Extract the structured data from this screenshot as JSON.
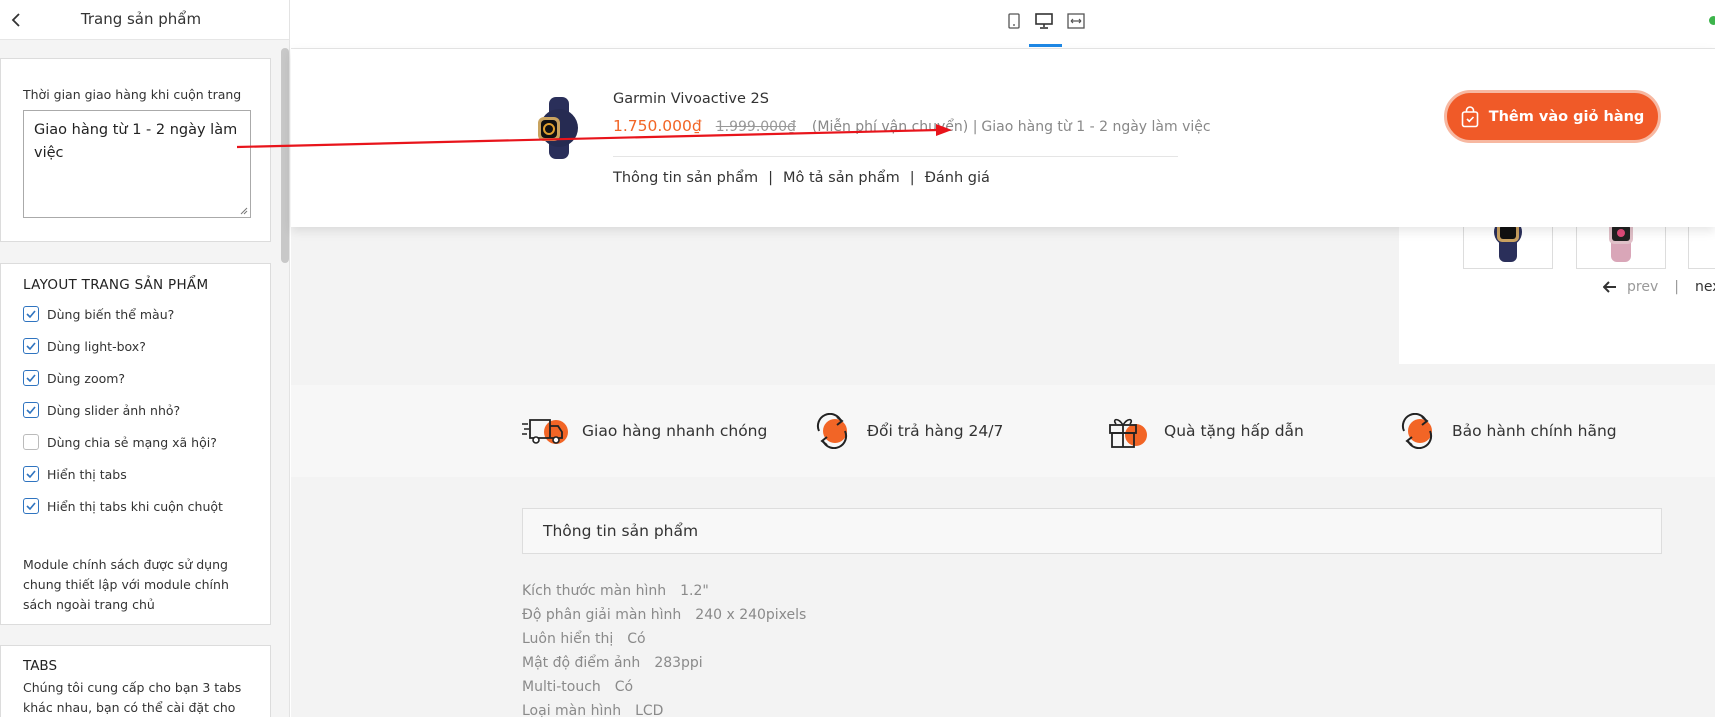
{
  "sidebar": {
    "title": "Trang sản phẩm",
    "delivery_field": {
      "label": "Thời gian giao hàng khi cuộn trang",
      "value": "Giao hàng từ 1 - 2 ngày làm việc"
    },
    "layout_section": {
      "title": "LAYOUT TRANG SẢN PHẨM",
      "options": [
        {
          "label": "Dùng biến thể màu?",
          "checked": true
        },
        {
          "label": "Dùng light-box?",
          "checked": true
        },
        {
          "label": "Dùng zoom?",
          "checked": true
        },
        {
          "label": "Dùng slider ảnh nhỏ?",
          "checked": true
        },
        {
          "label": "Dùng chia sẻ mạng xã hội?",
          "checked": false
        },
        {
          "label": "Hiển thị tabs",
          "checked": true
        },
        {
          "label": "Hiển thị tabs khi cuộn chuột",
          "checked": true
        }
      ],
      "note": "Module chính sách được sử dụng chung thiết lập với module chính sách ngoài trang chủ"
    },
    "tabs_section": {
      "title": "TABS",
      "description": "Chúng tôi cung cấp cho bạn 3 tabs khác nhau, bạn có thể cài đặt cho"
    }
  },
  "topbar": {
    "devices": [
      "mobile-icon",
      "desktop-icon",
      "fullwidth-icon"
    ],
    "active_device": "desktop-icon"
  },
  "sticky_bar": {
    "product_name": "Garmin Vivoactive 2S",
    "price": "1.750.000₫",
    "old_price": "1.999.000₫",
    "shipping_free": "(Miễn phí vận chuyển) |",
    "shipping_time": "Giao hàng từ 1 - 2 ngày làm việc",
    "tabs": [
      "Thông tin sản phẩm",
      "Mô tả sản phẩm",
      "Đánh giá"
    ],
    "tab_separator": "|",
    "cart_button": "Thêm vào giỏ hàng"
  },
  "gallery": {
    "prev": "prev",
    "sep": "|",
    "next": "next"
  },
  "policies": [
    {
      "icon": "delivery-truck-icon",
      "label": "Giao hàng nhanh chóng"
    },
    {
      "icon": "exchange-icon",
      "label": "Đổi trả hàng 24/7"
    },
    {
      "icon": "gift-icon",
      "label": "Quà tặng hấp dẫn"
    },
    {
      "icon": "warranty-icon",
      "label": "Bảo hành chính hãng"
    }
  ],
  "product_info": {
    "title": "Thông tin sản phẩm",
    "specs": [
      {
        "label": "Kích thước màn hình",
        "value": "1.2\""
      },
      {
        "label": "Độ phân giải màn hình",
        "value": "240 x 240pixels"
      },
      {
        "label": "Luôn hiển thị",
        "value": "Có"
      },
      {
        "label": "Mật độ điểm ảnh",
        "value": "283ppi"
      },
      {
        "label": "Multi-touch",
        "value": "Có"
      },
      {
        "label": "Loại màn hình",
        "value": "LCD"
      }
    ]
  },
  "colors": {
    "accent": "#f05a28",
    "price": "#f26526",
    "checkbox": "#2f74c0",
    "active_tab": "#1e88e5",
    "annotation_arrow": "#e8141b"
  }
}
